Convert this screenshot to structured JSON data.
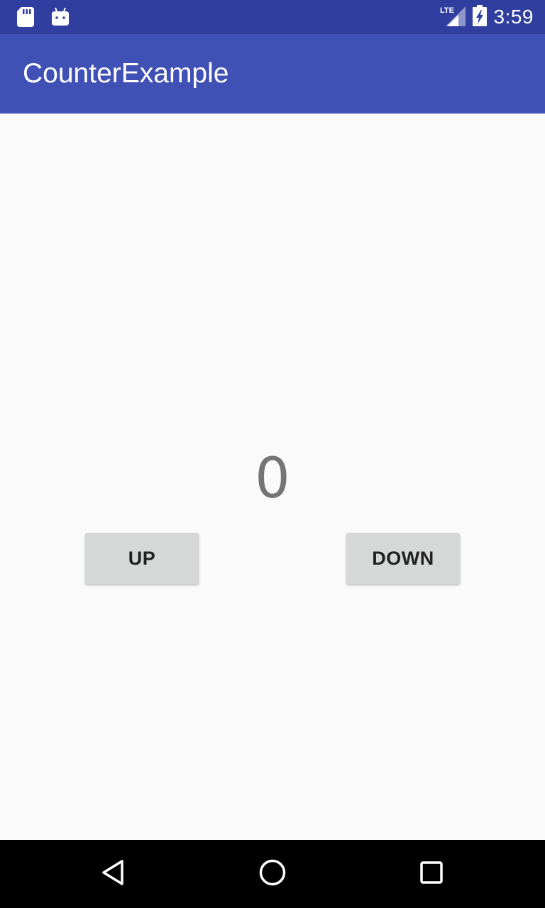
{
  "status_bar": {
    "time": "3:59",
    "network_label": "LTE",
    "icons": [
      "sd-card-icon",
      "android-icon",
      "lte-signal-icon",
      "battery-charging-icon"
    ],
    "background_color": "#303f9f"
  },
  "app_bar": {
    "title": "CounterExample",
    "background_color": "#3f51b5"
  },
  "counter": {
    "value": "0"
  },
  "buttons": {
    "up_label": "UP",
    "down_label": "DOWN"
  },
  "nav_bar": {
    "icons": [
      "back-icon",
      "home-icon",
      "recents-icon"
    ]
  }
}
